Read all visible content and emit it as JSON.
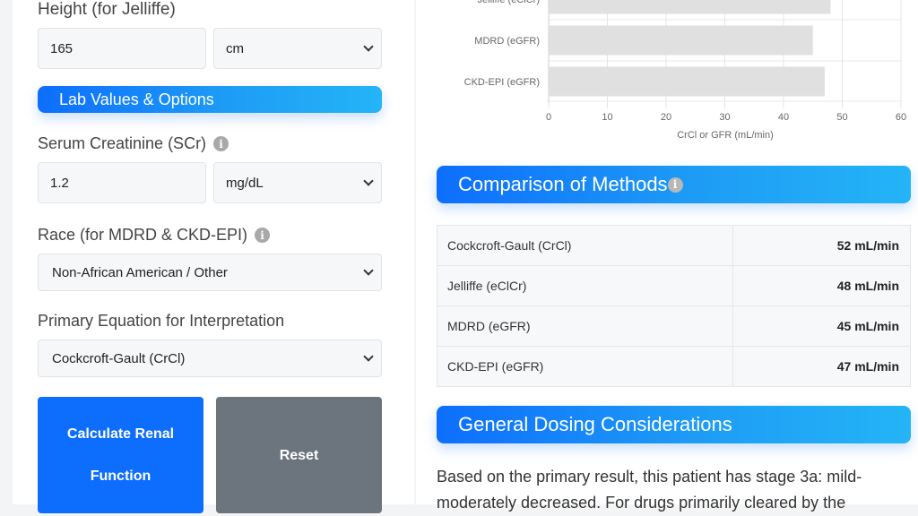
{
  "form": {
    "height_label": "Height (for Jelliffe)",
    "height_value": "165",
    "height_unit": "cm",
    "lab_section_title": "Lab Values & Options",
    "scr_label": "Serum Creatinine (SCr)",
    "scr_value": "1.2",
    "scr_unit": "mg/dL",
    "race_label": "Race (for MDRD & CKD-EPI)",
    "race_value": "Non-African American / Other",
    "primary_label": "Primary Equation for Interpretation",
    "primary_value": "Cockcroft-Gault (CrCl)",
    "calculate_button": "Calculate Renal Function",
    "reset_button": "Reset",
    "info_icon_glyph": "i"
  },
  "chart_data": {
    "type": "bar",
    "orientation": "horizontal",
    "categories": [
      "Jelliffe (eClCr)",
      "MDRD (eGFR)",
      "CKD-EPI (eGFR)"
    ],
    "values": [
      48,
      45,
      47
    ],
    "xlabel": "CrCl or GFR (mL/min)",
    "xlim": [
      0,
      60
    ],
    "xticks": [
      "0",
      "10",
      "20",
      "30",
      "40",
      "50",
      "60"
    ],
    "grid": true,
    "bar_color": "#e0e0e0"
  },
  "comparison": {
    "title": "Comparison of Methods",
    "rows": [
      {
        "method": "Cockcroft-Gault (CrCl)",
        "value": "52 mL/min"
      },
      {
        "method": "Jelliffe (eClCr)",
        "value": "48 mL/min"
      },
      {
        "method": "MDRD (eGFR)",
        "value": "45 mL/min"
      },
      {
        "method": "CKD-EPI (eGFR)",
        "value": "47 mL/min"
      }
    ]
  },
  "dosing": {
    "title": "General Dosing Considerations",
    "text": "Based on the primary result, this patient has stage 3a: mild-moderately decreased. For drugs primarily cleared by the"
  },
  "colors": {
    "accent": "#0d6efd",
    "pill_gradient_end": "#24b4f7",
    "reset_gray": "#6c757d"
  }
}
